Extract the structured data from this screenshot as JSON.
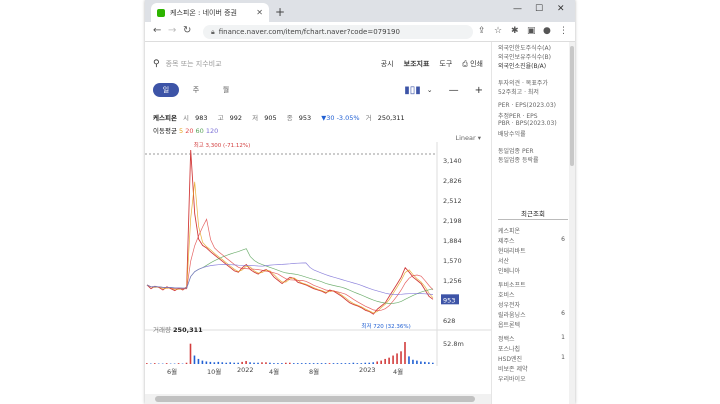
{
  "browser": {
    "tab_title": "케스피온 : 네이버 증권",
    "url": "finance.naver.com/item/fchart.naver?code=079190"
  },
  "search": {
    "placeholder": "종목 또는 지수비교",
    "menu": [
      "공시",
      "보조지표",
      "도구",
      "인쇄"
    ]
  },
  "toolbar": {
    "periods": [
      "일",
      "주",
      "월"
    ],
    "active_period": "일"
  },
  "stock": {
    "name": "케스피온",
    "open_label": "시",
    "open": "983",
    "high_label": "고",
    "high": "992",
    "low_label": "저",
    "low": "905",
    "close_label": "종",
    "close": "953",
    "change": "▼30 -3.05%",
    "volume_label": "거",
    "volume": "250,311"
  },
  "moving_avg": {
    "label": "이동평균",
    "periods": [
      "5",
      "20",
      "60",
      "120"
    ],
    "colors": [
      "#e4a21b",
      "#e04848",
      "#5aa35a",
      "#7a6fd6"
    ]
  },
  "scale_label": "Linear",
  "volume_panel": {
    "label": "거래량",
    "value": "250,311",
    "max_label": "52.8m"
  },
  "chart_data": {
    "type": "line",
    "yticks": [
      "3,140",
      "2,826",
      "2,512",
      "2,198",
      "1,884",
      "1,570",
      "1,256",
      "953",
      "628"
    ],
    "ylim": [
      628,
      3300
    ],
    "x_labels": [
      "6월",
      "10월",
      "2022",
      "4월",
      "8월",
      "2023",
      "4월"
    ],
    "annotations": {
      "max": "최고 3,300 (-71.12%)",
      "min": "최저 720 (32.36%)"
    },
    "current_price": "953",
    "series": [
      {
        "values": [
          1180,
          1120,
          1160,
          1140,
          1100,
          1150,
          1120,
          1090,
          1130,
          1100,
          1150,
          3300,
          2300,
          1900,
          1800,
          1760,
          1700,
          1650,
          1600,
          1550,
          1500,
          1450,
          1400,
          1380,
          1450,
          1500,
          1420,
          1380,
          1350,
          1400,
          1420,
          1380,
          1300,
          1250,
          1200,
          1250,
          1300,
          1280,
          1220,
          1200,
          1180,
          1150,
          1120,
          1100,
          1080,
          1050,
          1100,
          1080,
          1040,
          1000,
          950,
          900,
          870,
          850,
          820,
          780,
          760,
          720,
          800,
          850,
          900,
          1000,
          1100,
          1200,
          1300,
          1450,
          1380,
          1300,
          1250,
          1200,
          1100,
          1000,
          953
        ]
      }
    ],
    "volume": [
      2,
      1,
      2,
      1,
      1,
      2,
      1,
      1,
      2,
      1,
      3,
      48,
      20,
      12,
      8,
      6,
      5,
      4,
      5,
      4,
      3,
      4,
      3,
      3,
      5,
      7,
      4,
      3,
      3,
      4,
      4,
      3,
      2,
      2,
      2,
      3,
      3,
      2,
      2,
      2,
      2,
      2,
      2,
      2,
      2,
      2,
      2,
      2,
      2,
      2,
      2,
      2,
      3,
      2,
      2,
      3,
      3,
      4,
      6,
      8,
      12,
      15,
      20,
      25,
      30,
      52,
      18,
      10,
      8,
      6,
      5,
      4,
      3
    ]
  },
  "sidebar": {
    "top_items": [
      "외국인한도주식수(A)",
      "외국인보유주식수(B)",
      "외국인소진율(B/A)"
    ],
    "items_2": [
      "투자의견 · 목표주가",
      "52주최고 · 최저"
    ],
    "items_3": [
      "PER · EPS(2023.03)",
      "추정PER · EPS",
      "PBR · BPS(2023.03)",
      "배당수익률"
    ],
    "items_4": [
      "동일업종 PER",
      "동일업종 등락률"
    ],
    "recent_title": "최근조회",
    "recent": [
      {
        "name": "케스피온",
        "num": ""
      },
      {
        "name": "제주스",
        "num": "6"
      },
      {
        "name": "현대리바트",
        "num": ""
      },
      {
        "name": "서산",
        "num": ""
      },
      {
        "name": "인베니아",
        "num": ""
      },
      {
        "name": "투비소프트",
        "num": ""
      },
      {
        "name": "호비스",
        "num": ""
      },
      {
        "name": "성우전자",
        "num": ""
      },
      {
        "name": "릴라움닝스",
        "num": "6"
      },
      {
        "name": "옵트론텍",
        "num": ""
      },
      {
        "name": "정백스",
        "num": "1"
      },
      {
        "name": "포스나칩",
        "num": ""
      },
      {
        "name": "HSD엔진",
        "num": "1"
      },
      {
        "name": "비보존 제약",
        "num": ""
      },
      {
        "name": "우리바이오",
        "num": ""
      }
    ]
  }
}
